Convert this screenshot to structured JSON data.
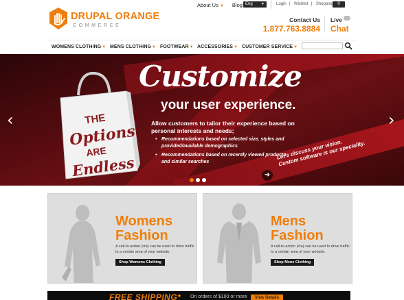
{
  "brand": {
    "name": "DRUPAL ORANGE",
    "tagline": "COMMERCE",
    "accent": "#ef7e0a"
  },
  "topnav": {
    "about": "About Us",
    "blog": "Blog",
    "language": "Eng",
    "login": "Login",
    "wishlist": "Wishlist",
    "cart": "Shopping Cart",
    "cart_count": "0"
  },
  "contact": {
    "label": "Contact Us",
    "phone": "1.877.763.8884",
    "live_label": "Live",
    "chat_label": "Chat"
  },
  "mainnav": {
    "items": [
      {
        "label": "WOMENS CLOTHING"
      },
      {
        "label": "MENS CLOTHING"
      },
      {
        "label": "FOOTWEAR"
      },
      {
        "label": "ACCESSORIES"
      },
      {
        "label": "CUSTOMER SERVICE"
      }
    ],
    "search_placeholder": ""
  },
  "hero": {
    "headline": "Customize",
    "subhead": "your user experience.",
    "bag_text": [
      "THE",
      "Options",
      "ARE",
      "Endless"
    ],
    "description": "Allow customers to tailor their experience based on personal interests and needs;",
    "bullets": [
      "Recommendations based on selected size, styles and provided/available demographics",
      "Recommendations based on recently viewed products and similar searches"
    ],
    "cta_line1": "Let's discuss your vision.",
    "cta_line2": "Custom software is our speciality.",
    "slides": 3,
    "active_slide": 1
  },
  "cards": [
    {
      "title_line1": "Womens",
      "title_line2": "Fashion",
      "description": "A call-to-action (cta) can be used to drive traffic to a certain area of your website.",
      "button": "Shop Womens Clothing"
    },
    {
      "title_line1": "Mens",
      "title_line2": "Fashion",
      "description": "A call-to-action (cta) can be used to drive traffic to a certain area of your website.",
      "button": "Shop Mens Clothing"
    }
  ],
  "shipping": {
    "title": "FREE SHIPPING*",
    "text": "On orders of $100 or more",
    "button": "View Details"
  }
}
